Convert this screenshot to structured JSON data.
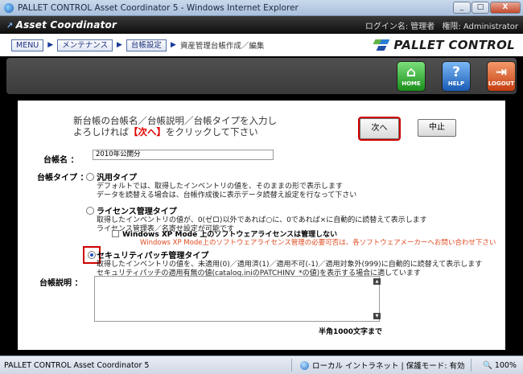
{
  "window": {
    "title": "PALLET CONTROL Asset Coordinator 5 - Windows Internet Explorer",
    "minimize": "_",
    "maximize": "□",
    "close": "X"
  },
  "app": {
    "brand": "Asset Coordinator",
    "login_label": "ログイン名:",
    "login_value": "管理者",
    "authority_label": "権限:",
    "authority_value": "Administrator"
  },
  "breadcrumb": {
    "items": [
      "MENU",
      "メンテナンス",
      "台帳設定"
    ],
    "current": "資産管理台帳作成／編集",
    "arrow": "▶"
  },
  "logo": {
    "text": "PALLET CONTROL"
  },
  "toolbar": {
    "home": {
      "label": "HOME",
      "icon": "house-icon",
      "glyph": "⌂"
    },
    "help": {
      "label": "HELP",
      "icon": "question-icon",
      "glyph": "?"
    },
    "logout": {
      "label": "LOGOUT",
      "icon": "door-icon",
      "glyph": "⇥"
    }
  },
  "form": {
    "intro_line1": "新台帳の台帳名／台帳説明／台帳タイプを入力し",
    "intro_line2_pre": "よろしければ",
    "intro_line2_red": "【次へ】",
    "intro_line2_post": "をクリックして下さい",
    "next_button": "次へ",
    "cancel_button": "中止",
    "name_label": "台帳名 ：",
    "name_value": "2010年公開分",
    "type_label": "台帳タイプ ：",
    "options": [
      {
        "title": "汎用タイプ",
        "desc1": "デフォルトでは、取得したインベントリの値を、そのままの形で表示します",
        "desc2": "データを読替える場合は、台帳作成後に表示データ読替え設定を行なって下さい",
        "selected": false
      },
      {
        "title": "ライセンス管理タイプ",
        "desc1": "取得したインベントリの値が、0(ゼロ)以外であれば○に、0であれば×に自動的に読替えて表示します",
        "desc2": "ライセンス管理表／名寄せ設定が可能です",
        "selected": false
      },
      {
        "title": "セキュリティパッチ管理タイプ",
        "desc1": "取得したインベントリの値を、未適用(0)／適用済(1)／適用不可(-1)／適用対象外(999)に自動的に読替えて表示します",
        "desc2": "セキュリティパッチの適用有無の値(catalog.iniのPATCHINV_*の値)を表示する場合に適しています",
        "selected": true
      }
    ],
    "xp_mode_label": "Windows XP Mode 上のソフトウェアライセンスは管理しない",
    "xp_mode_note": "Windows XP Mode上のソフトウェアライセンス管理の必要可否は、各ソフトウェアメーカーへお問い合わせ下さい",
    "desc_label": "台帳説明 ：",
    "desc_value": "",
    "limit_note": "半角1000文字まで"
  },
  "statusbar": {
    "left": "PALLET CONTROL Asset Coordinator 5",
    "zone": "ローカル イントラネット | 保護モード: 有効",
    "zoom": "100%"
  }
}
